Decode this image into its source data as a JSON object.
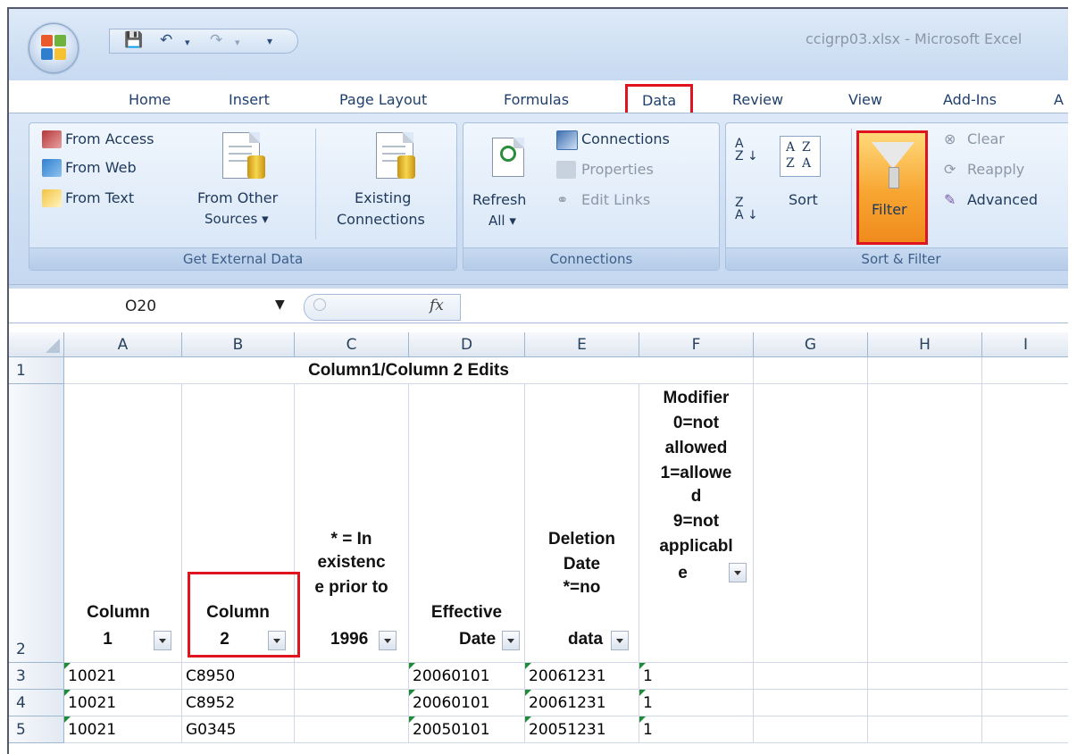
{
  "window": {
    "title": "ccigrp03.xlsx - Microsoft Excel"
  },
  "quick_access": {
    "save_icon": "save-icon",
    "undo_icon": "undo-icon",
    "redo_icon": "redo-icon",
    "dropdown": "▾"
  },
  "tabs": [
    "Home",
    "Insert",
    "Page Layout",
    "Formulas",
    "Data",
    "Review",
    "View",
    "Add-Ins",
    "A"
  ],
  "ribbon": {
    "get_external": {
      "from_access": "From Access",
      "from_web": "From Web",
      "from_text": "From Text",
      "from_other_1": "From Other",
      "from_other_2": "Sources ▾",
      "existing_1": "Existing",
      "existing_2": "Connections",
      "label": "Get External Data"
    },
    "connections": {
      "refresh_1": "Refresh",
      "refresh_2": "All ▾",
      "connections": "Connections",
      "properties": "Properties",
      "edit_links": "Edit Links",
      "label": "Connections"
    },
    "sort_filter": {
      "sort": "Sort",
      "filter": "Filter",
      "clear": "Clear",
      "reapply": "Reapply",
      "advanced": "Advanced",
      "label": "Sort & Filter"
    }
  },
  "formula_bar": {
    "name_box": "O20",
    "fx": "fx",
    "value": ""
  },
  "columns": [
    "A",
    "B",
    "C",
    "D",
    "E",
    "F",
    "G",
    "H",
    "I"
  ],
  "rows": [
    "1",
    "2",
    "3",
    "4",
    "5"
  ],
  "title_cell": "Column1/Column 2 Edits",
  "headers": {
    "a": [
      "Column",
      "1"
    ],
    "b": [
      "Column",
      "2"
    ],
    "c": [
      "* = In",
      "existenc",
      "e prior to",
      "1996"
    ],
    "d": [
      "Effective",
      "Date"
    ],
    "e": [
      "Deletion",
      "Date",
      "*=no",
      "data"
    ],
    "f": [
      "Modifier",
      "0=not",
      "allowed",
      "1=allowe",
      "d",
      "9=not",
      "applicabl",
      "e"
    ]
  },
  "data_rows": [
    [
      "10021",
      "C8950",
      "",
      "20060101",
      "20061231",
      "1"
    ],
    [
      "10021",
      "C8952",
      "",
      "20060101",
      "20061231",
      "1"
    ],
    [
      "10021",
      "G0345",
      "",
      "20050101",
      "20051231",
      "1"
    ]
  ],
  "colors": {
    "highlight": "#e0141e",
    "ribbon": "#c5d8f0",
    "filter_active": "#f7a531"
  }
}
